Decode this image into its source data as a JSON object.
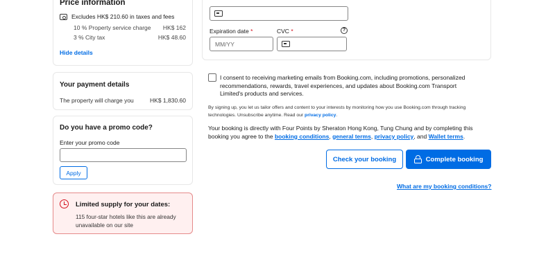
{
  "price_info": {
    "title": "Price information",
    "excludes": "Excludes HK$ 210.60 in taxes and fees",
    "fees": [
      {
        "label": "10 % Property service charge",
        "value": "HK$ 162"
      },
      {
        "label": "3 % City tax",
        "value": "HK$ 48.60"
      }
    ],
    "hide_details": "Hide details"
  },
  "payment_details": {
    "title": "Your payment details",
    "charge_label": "The property will charge you",
    "charge_value": "HK$ 1,830.60"
  },
  "promo": {
    "title": "Do you have a promo code?",
    "label": "Enter your promo code",
    "apply": "Apply"
  },
  "supply": {
    "title": "Limited supply for your dates:",
    "body": "115 four-star hotels like this are already unavailable on our site"
  },
  "card_form": {
    "expiration_label": "Expiration date",
    "expiration_placeholder": "MM/YY",
    "cvc_label": "CVC",
    "required_mark": "*",
    "help_glyph": "?"
  },
  "consent": {
    "text": "I consent to receiving marketing emails from Booking.com, including promotions, personalized recommendations, rewards, travel experiences, and updates about Booking.com Transport Limited's products and services."
  },
  "signup": {
    "text": "By signing up, you let us tailor offers and content to your interests by monitoring how you use Booking.com through tracking technologies. Unsubscribe anytime. Read our",
    "privacy_link": "privacy policy",
    "end": "."
  },
  "booking": {
    "text": "Your booking is directly with Four Points by Sheraton Hong Kong, Tung Chung and by completing this booking you agree to the",
    "booking_conditions": "booking conditions",
    "sep1": ",",
    "general_terms": "general terms",
    "sep2": ",",
    "privacy_policy": "privacy policy",
    "sep3": ", and",
    "wallet_terms": "Wallet terms",
    "end": "."
  },
  "actions": {
    "check": "Check your booking",
    "complete": "Complete booking",
    "conditions_link": "What are my booking conditions?"
  },
  "colors": {
    "brand_blue": "#006ce4",
    "alert_red": "#d4111e",
    "alert_bg": "#fff0f0"
  }
}
